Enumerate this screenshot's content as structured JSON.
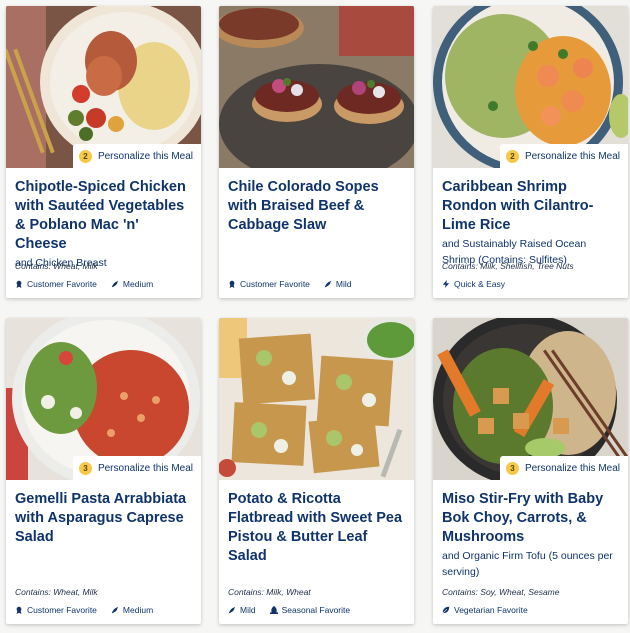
{
  "personalize_label": "Personalize this Meal",
  "meals": [
    {
      "title": "Chipotle-Spiced Chicken with Sautéed Vegetables & Poblano Mac 'n' Cheese",
      "subtitle": "and Chicken Breast",
      "contains": "Contains: Wheat, Milk",
      "personalize_count": "2",
      "tags": [
        {
          "label": "Customer Favorite",
          "icon": "award-icon"
        },
        {
          "label": "Medium",
          "icon": "pepper-icon"
        }
      ]
    },
    {
      "title": "Chile Colorado Sopes with Braised Beef & Cabbage Slaw",
      "subtitle": "",
      "contains": "",
      "personalize_count": "",
      "tags": [
        {
          "label": "Customer Favorite",
          "icon": "award-icon"
        },
        {
          "label": "Mild",
          "icon": "pepper-icon"
        }
      ]
    },
    {
      "title": "Caribbean Shrimp Rondon with Cilantro-Lime Rice",
      "subtitle": "and Sustainably Raised Ocean Shrimp (Contains: Sulfites)",
      "contains": "Contains: Milk, Shellfish, Tree Nuts",
      "personalize_count": "2",
      "tags": [
        {
          "label": "Quick & Easy",
          "icon": "lightning-icon"
        }
      ]
    },
    {
      "title": "Gemelli Pasta Arrabbiata with Asparagus Caprese Salad",
      "subtitle": "",
      "contains": "Contains: Wheat, Milk",
      "personalize_count": "3",
      "tags": [
        {
          "label": "Customer Favorite",
          "icon": "award-icon"
        },
        {
          "label": "Medium",
          "icon": "pepper-icon"
        }
      ]
    },
    {
      "title": "Potato & Ricotta Flatbread with Sweet Pea Pistou & Butter Leaf Salad",
      "subtitle": "",
      "contains": "Contains: Milk, Wheat",
      "personalize_count": "",
      "tags": [
        {
          "label": "Mild",
          "icon": "pepper-icon"
        },
        {
          "label": "Seasonal Favorite",
          "icon": "seasonal-icon"
        }
      ]
    },
    {
      "title": "Miso Stir-Fry with Baby Bok Choy, Carrots, & Mushrooms",
      "subtitle": "and Organic Firm Tofu (5 ounces per serving)",
      "contains": "Contains: Soy, Wheat, Sesame",
      "personalize_count": "3",
      "tags": [
        {
          "label": "Vegetarian Favorite",
          "icon": "leaf-icon"
        }
      ]
    }
  ]
}
